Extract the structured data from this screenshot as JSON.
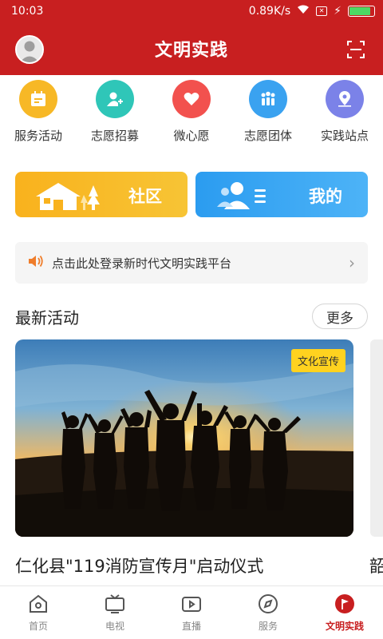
{
  "status_bar": {
    "time": "10:03",
    "net_speed": "0.89K/s",
    "sim_glyph": "✕",
    "charging_glyph": "⚡",
    "battery_fraction": 0.85
  },
  "header": {
    "title": "文明实践",
    "avatar_icon": "user-avatar",
    "scan_icon": "scan-icon"
  },
  "quick_actions": [
    {
      "label": "服务活动",
      "icon": "calendar-icon",
      "color": "#f7b826"
    },
    {
      "label": "志愿招募",
      "icon": "add-user-icon",
      "color": "#2fc6b8"
    },
    {
      "label": "微心愿",
      "icon": "heart-icon",
      "color": "#f2514e"
    },
    {
      "label": "志愿团体",
      "icon": "group-icon",
      "color": "#3aa2f0"
    },
    {
      "label": "实践站点",
      "icon": "location-icon",
      "color": "#7b82e8"
    }
  ],
  "big_cards": {
    "community": "社区",
    "mine": "我的"
  },
  "notice": {
    "text": "点击此处登录新时代文明实践平台",
    "icon": "speaker-icon"
  },
  "latest": {
    "title": "最新活动",
    "more": "更多"
  },
  "activity": {
    "tag": "文化宣传",
    "title": "仁化县\"119消防宣传月\"启动仪式",
    "next_title_peek": "韶"
  },
  "tabs": [
    {
      "label": "首页",
      "icon": "home-icon",
      "active": false
    },
    {
      "label": "电视",
      "icon": "tv-icon",
      "active": false
    },
    {
      "label": "直播",
      "icon": "video-icon",
      "active": false
    },
    {
      "label": "服务",
      "icon": "compass-icon",
      "active": false
    },
    {
      "label": "文明实践",
      "icon": "flag-icon",
      "active": true
    }
  ],
  "colors": {
    "brand_red": "#c81f20",
    "community_yellow": "#f9b21d",
    "mine_blue": "#2b9cf0",
    "badge_yellow": "#ffd21f"
  }
}
